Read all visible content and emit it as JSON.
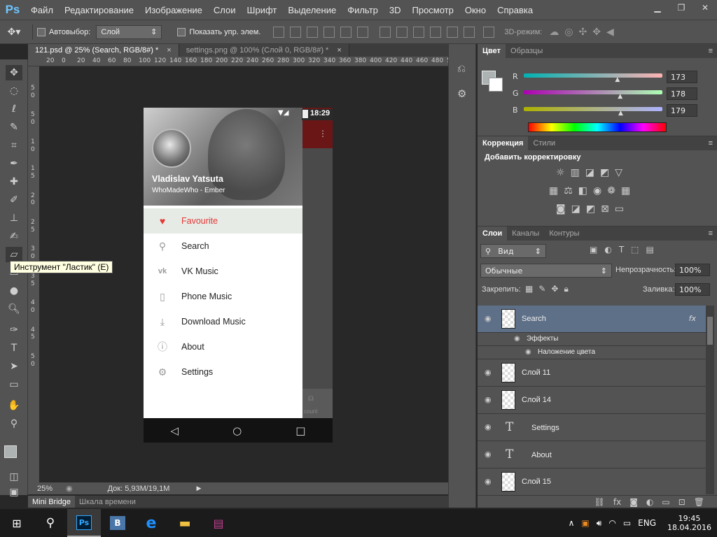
{
  "app": {
    "logo": "Ps"
  },
  "menu": [
    "Файл",
    "Редактирование",
    "Изображение",
    "Слои",
    "Шрифт",
    "Выделение",
    "Фильтр",
    "3D",
    "Просмотр",
    "Окно",
    "Справка"
  ],
  "options": {
    "autoselect_label": "Автовыбор:",
    "autoselect_value": "Слой",
    "show_controls_label": "Показать упр. элем.",
    "mode3d_label": "3D-режим:"
  },
  "tabs": [
    {
      "label": "121.psd @ 25% (Search, RGB/8#) *"
    },
    {
      "label": "settings.png @ 100% (Слой 0, RGB/8#) *"
    }
  ],
  "tooltip": "Инструмент \"Ластик\" (E)",
  "ruler_top": [
    "20",
    "0",
    "20",
    "40",
    "60",
    "80",
    "100",
    "120",
    "140",
    "160",
    "180",
    "200",
    "220",
    "240",
    "260",
    "280",
    "300",
    "320",
    "340",
    "360",
    "380",
    "400",
    "420",
    "440",
    "460",
    "480",
    "500"
  ],
  "ruler_left": [
    "5",
    "0",
    "5",
    "0",
    "1",
    "0",
    "1",
    "5",
    "2",
    "0",
    "2",
    "5",
    "3",
    "0",
    "3",
    "5",
    "4",
    "0",
    "4",
    "5",
    "5",
    "0"
  ],
  "status": {
    "zoom": "25%",
    "doc": "Док: 5,93M/19,1M"
  },
  "bottom_tabs": [
    "Mini Bridge",
    "Шкала времени"
  ],
  "phone": {
    "time": "18:29",
    "user_name": "Vladislav Yatsuta",
    "user_sub": "WhoMadeWho - Ember",
    "items": [
      {
        "label": "Favourite",
        "icon": "heart-icon",
        "glyph": "♥"
      },
      {
        "label": "Search",
        "icon": "search-icon",
        "glyph": "⚲"
      },
      {
        "label": "VK Music",
        "icon": "vk-icon",
        "glyph": "vk"
      },
      {
        "label": "Phone Music",
        "icon": "phone-icon",
        "glyph": "▯"
      },
      {
        "label": "Download Music",
        "icon": "download-icon",
        "glyph": "⤓"
      },
      {
        "label": "About",
        "icon": "info-icon",
        "glyph": "ⓘ"
      },
      {
        "label": "Settings",
        "icon": "gear-icon",
        "glyph": "⚙"
      }
    ],
    "behind_text": "count"
  },
  "color_panel": {
    "tabs": [
      "Цвет",
      "Образцы"
    ],
    "r_label": "R",
    "g_label": "G",
    "b_label": "B",
    "r": "173",
    "g": "178",
    "b": "179"
  },
  "correction_panel": {
    "tabs": [
      "Коррекция",
      "Стили"
    ],
    "heading": "Добавить корректировку"
  },
  "layers_panel": {
    "tabs": [
      "Слои",
      "Каналы",
      "Контуры"
    ],
    "filter": "Вид",
    "blend_mode": "Обычные",
    "opacity_label": "Непрозрачность:",
    "opacity": "100%",
    "lock_label": "Закрепить:",
    "fill_label": "Заливка:",
    "fill": "100%",
    "layers": [
      {
        "name": "Search",
        "selected": true,
        "fx": "fx"
      },
      {
        "name": "Эффекты",
        "sub": true
      },
      {
        "name": "Наложение цвета",
        "sub": true
      },
      {
        "name": "Слой 11"
      },
      {
        "name": "Слой 14"
      },
      {
        "name": "Settings",
        "text": true
      },
      {
        "name": "About",
        "text": true
      },
      {
        "name": "Слой 15"
      }
    ]
  },
  "taskbar": {
    "time": "19:45",
    "date": "18.04.2016",
    "lang": "ENG"
  },
  "colors": {
    "accent_red": "#e53935",
    "ps_blue": "#6ec6ff",
    "selected_layer": "#5e6f88"
  }
}
